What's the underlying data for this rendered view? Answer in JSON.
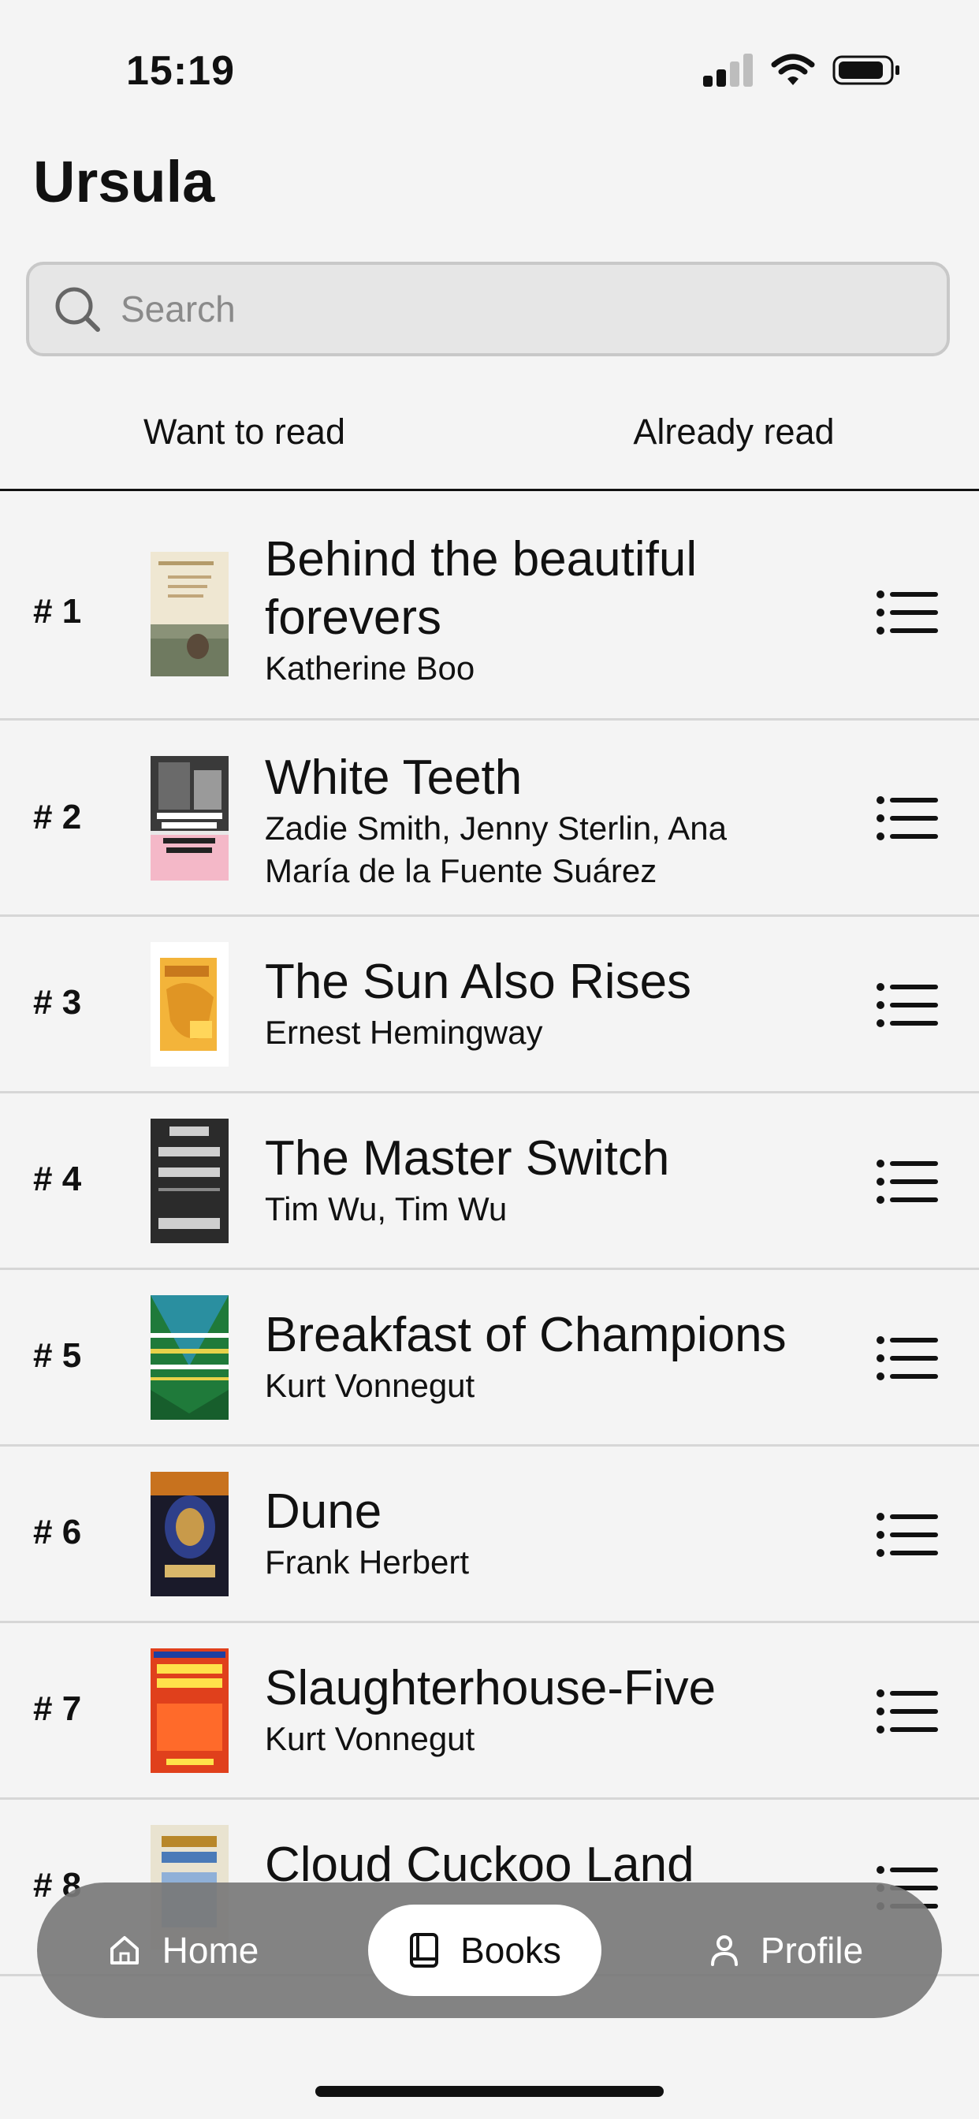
{
  "status": {
    "time": "15:19"
  },
  "header": {
    "title": "Ursula"
  },
  "search": {
    "placeholder": "Search",
    "value": ""
  },
  "tabs": [
    {
      "label": "Want to read",
      "active": true
    },
    {
      "label": "Already read",
      "active": false
    }
  ],
  "books": [
    {
      "rank": "# 1",
      "title": "Behind the beautiful forevers",
      "author": "Katherine Boo"
    },
    {
      "rank": "# 2",
      "title": "White Teeth",
      "author": "Zadie Smith, Jenny Sterlin, Ana María de la Fuente Suárez"
    },
    {
      "rank": "# 3",
      "title": "The Sun Also Rises",
      "author": "Ernest Hemingway"
    },
    {
      "rank": "# 4",
      "title": "The Master Switch",
      "author": "Tim Wu, Tim Wu"
    },
    {
      "rank": "# 5",
      "title": "Breakfast of Champions",
      "author": "Kurt Vonnegut"
    },
    {
      "rank": "# 6",
      "title": "Dune",
      "author": "Frank Herbert"
    },
    {
      "rank": "# 7",
      "title": "Slaughterhouse-Five",
      "author": "Kurt Vonnegut"
    },
    {
      "rank": "# 8",
      "title": "Cloud Cuckoo Land",
      "author": ""
    }
  ],
  "nav": {
    "home": "Home",
    "books": "Books",
    "profile": "Profile"
  }
}
